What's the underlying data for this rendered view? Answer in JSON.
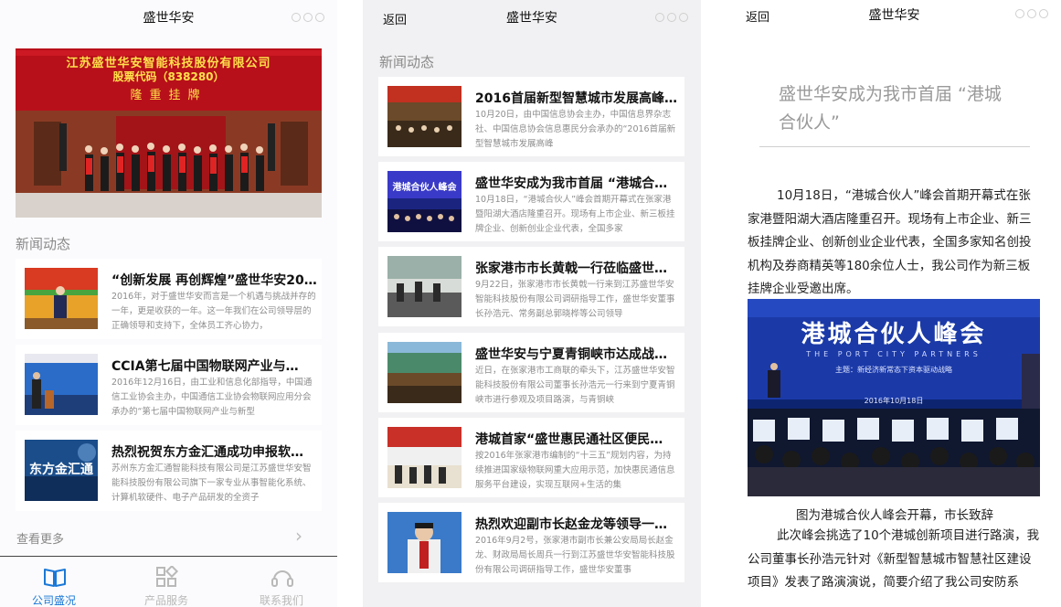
{
  "screen1": {
    "title": "盛世华安",
    "banner": {
      "line1": "江苏盛世华安智能科技股份有限公司",
      "line2": "股票代码（838280）",
      "line3": "隆重挂牌"
    },
    "section_title": "新闻动态",
    "news": [
      {
        "title": "“创新发展 再创辉煌”盛世华安20…",
        "desc": "2016年，对于盛世华安而言是一个机遇与挑战并存的一年，更是收获的一年。这一年我们在公司领导层的正确领导和支持下，全体员工齐心协力，"
      },
      {
        "title": "CCIA第七届中国物联网产业与…",
        "desc": "2016年12月16日，由工业和信息化部指导，中国通信工业协会主办，中国通信工业协会物联网应用分会承办的“第七届中国物联网产业与新型"
      },
      {
        "title": "热烈祝贺东方金汇通成功申报软…",
        "desc": "苏州东方金汇通智能科技有限公司是江苏盛世华安智能科技股份有限公司旗下一家专业从事智能化系统、计算机软硬件、电子产品研发的全资子"
      }
    ],
    "thumb3_text": "东方金汇通",
    "more_label": "查看更多",
    "more_chevron": "›",
    "tabs": [
      {
        "label": "公司盛况",
        "icon": "book-icon",
        "active": true
      },
      {
        "label": "产品服务",
        "icon": "grid-icon",
        "active": false
      },
      {
        "label": "联系我们",
        "icon": "headset-icon",
        "active": false
      }
    ],
    "active_color": "#1a78d6",
    "inactive_color": "#b9b9b9"
  },
  "screen2": {
    "back_label": "返回",
    "title": "盛世华安",
    "section_title": "新闻动态",
    "news": [
      {
        "title": "2016首届新型智慧城市发展高峰…",
        "desc": "10月20日，由中国信息协会主办，中国信息界杂志社、中国信息协会信息惠民分会承办的“2016首届新型智慧城市发展高峰"
      },
      {
        "title": "盛世华安成为我市首届 “港城合…",
        "desc": "10月18日，“港城合伙人”峰会首期开幕式在张家港暨阳湖大酒店隆重召开。现场有上市企业、新三板挂牌企业、创新创业企业代表，全国多家"
      },
      {
        "title": "张家港市市长黄戟一行莅临盛世…",
        "desc": "9月22日，张家港市市长黄戟一行来到江苏盛世华安智能科技股份有限公司调研指导工作，盛世华安董事长孙浩元、常务副总郭晓桦等公司领导"
      },
      {
        "title": "盛世华安与宁夏青铜峡市达成战…",
        "desc": "近日，在张家港市工商联的牵头下，江苏盛世华安智能科技股份有限公司董事长孙浩元一行来到宁夏青铜峡市进行参观及项目路演，与青铜峡"
      },
      {
        "title": "港城首家“盛世惠民通社区便民…",
        "desc": "按2016年张家港市编制的“十三五”规划内容，为持续推进国家级物联网重大应用示范，加快惠民通信息服务平台建设，实现互联网+生活的集"
      },
      {
        "title": "热烈欢迎副市长赵金龙等领导一…",
        "desc": "2016年9月2号，张家港市副市长兼公安局局长赵金龙、财政局局长周兵一行到江苏盛世华安智能科技股份有限公司调研指导工作，盛世华安董事"
      }
    ],
    "thumb2_text": "港城合伙人峰会"
  },
  "screen3": {
    "back_label": "返回",
    "title": "盛世华安",
    "article_title": "盛世华安成为我市首届 “港城合伙人”",
    "paragraph1": "10月18日，“港城合伙人”峰会首期开幕式在张家港暨阳湖大酒店隆重召开。现场有上市企业、新三板挂牌企业、创新创业企业代表，全国多家知名创投机构及券商精英等180余位人士，我公司作为新三板挂牌企业受邀出席。",
    "photo": {
      "headline": "港城合伙人峰会",
      "subtitle": "THE PORT CITY PARTNERS",
      "theme": "主题：新经济新常态下资本驱动战略",
      "date": "2016年10月18日"
    },
    "caption": "图为港城合伙人峰会开幕，市长致辞",
    "paragraph2": "此次峰会挑选了10个港城创新项目进行路演，我公司董事长孙浩元针对《新型智慧城市智慧社区建设项目》发表了路演演说，简要介绍了我公司安防系"
  }
}
